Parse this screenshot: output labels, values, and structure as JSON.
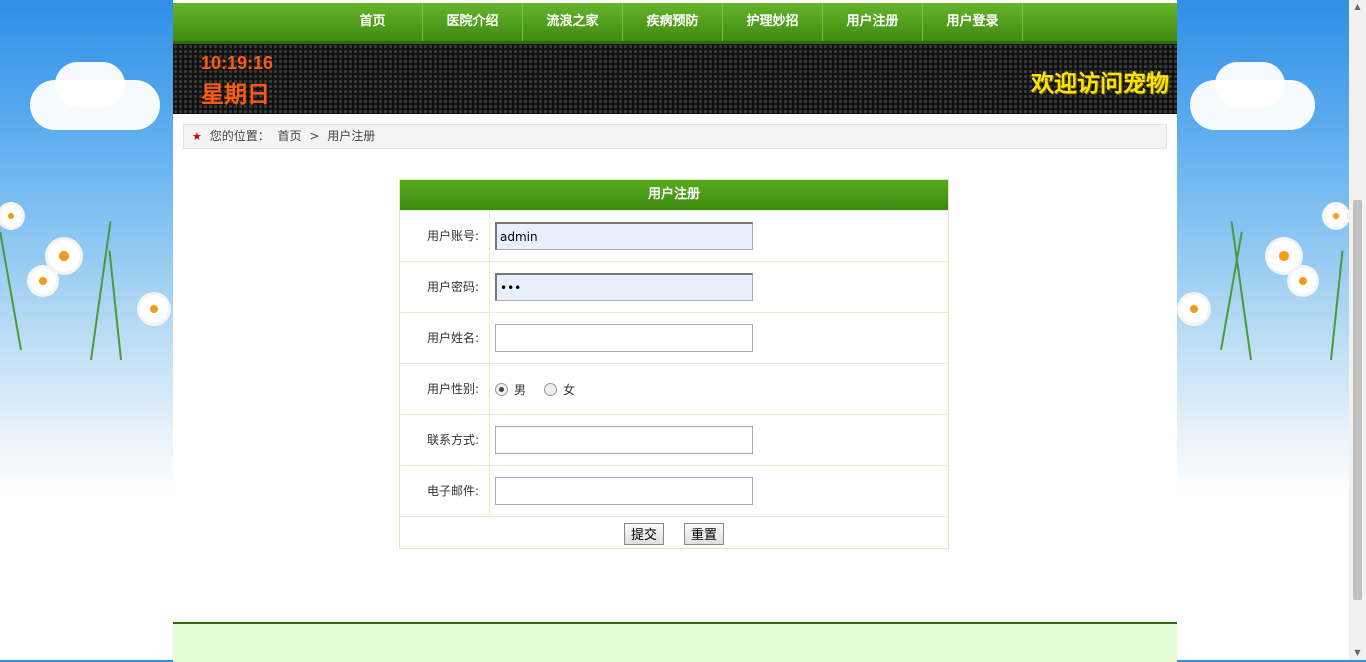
{
  "nav": {
    "items": [
      "首页",
      "医院介绍",
      "流浪之家",
      "疾病预防",
      "护理妙招",
      "用户注册",
      "用户登录"
    ]
  },
  "banner": {
    "time": "10:19:16",
    "weekday": "星期日",
    "welcome": "欢迎访问宠物"
  },
  "breadcrumb": {
    "prefix": "您的位置：",
    "home": "首页",
    "separator": ">",
    "current": "用户注册"
  },
  "form": {
    "title": "用户注册",
    "account_label": "用户账号:",
    "account_value": "admin",
    "password_label": "用户密码:",
    "password_value": "•••",
    "name_label": "用户姓名:",
    "name_value": "",
    "gender_label": "用户性别:",
    "gender_male": "男",
    "gender_female": "女",
    "gender_selected": "男",
    "contact_label": "联系方式:",
    "contact_value": "",
    "email_label": "电子邮件:",
    "email_value": "",
    "submit_label": "提交",
    "reset_label": "重置"
  },
  "colors": {
    "nav_green": "#4a9a18",
    "clock_orange": "#ff5a14",
    "welcome_yellow": "#ffe200",
    "breadcrumb_star": "#cc0000"
  },
  "icons": {
    "breadcrumb": "star-icon"
  }
}
